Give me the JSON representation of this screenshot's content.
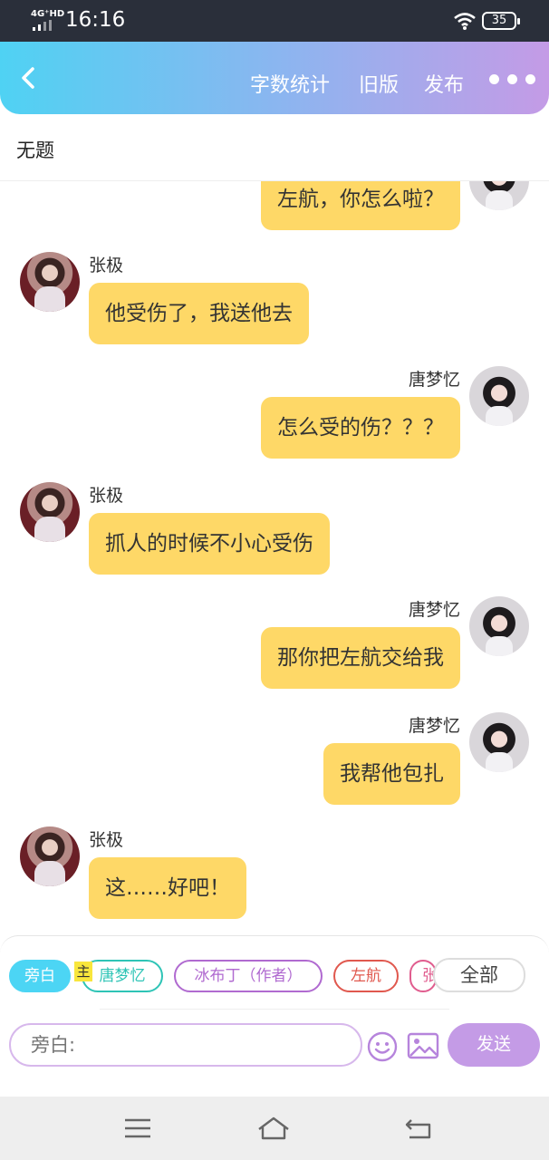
{
  "status_bar": {
    "network": "4G⁺HD",
    "time": "16:16",
    "battery": "35"
  },
  "header": {
    "word_count_label": "字数统计",
    "old_version_label": "旧版",
    "publish_label": "发布",
    "back_icon": "chevron-left-icon",
    "more_icon": "more-dots-icon"
  },
  "story_title": "无题",
  "messages": [
    {
      "side": "right",
      "speaker": "",
      "text": "左航，你怎么啦？"
    },
    {
      "side": "left",
      "speaker": "张极",
      "text": "他受伤了，我送他去"
    },
    {
      "side": "right",
      "speaker": "唐梦忆",
      "text": "怎么受的伤？？？"
    },
    {
      "side": "left",
      "speaker": "张极",
      "text": "抓人的时候不小心受伤"
    },
    {
      "side": "right",
      "speaker": "唐梦忆",
      "text": "那你把左航交给我"
    },
    {
      "side": "right",
      "speaker": "唐梦忆",
      "text": "我帮他包扎"
    },
    {
      "side": "left",
      "speaker": "张极",
      "text": "这……好吧！"
    }
  ],
  "roles": {
    "items": [
      {
        "label": "旁白",
        "color": "#4cd5f4"
      },
      {
        "label": "唐梦忆",
        "color": "#2ec4b6"
      },
      {
        "label": "冰布丁（作者）",
        "color": "#b06ad0"
      },
      {
        "label": "左航",
        "color": "#e0584e"
      },
      {
        "label": "张",
        "color": "#e05c8e"
      }
    ],
    "main_tag": "主",
    "all_label": "全部"
  },
  "composer": {
    "placeholder": "旁白:",
    "send_label": "发送",
    "emoji_icon": "smiley-icon",
    "image_icon": "image-icon"
  },
  "colors": {
    "bubble": "#fed867",
    "accent_purple": "#c49be6",
    "accent_cyan": "#4cd5f4"
  }
}
